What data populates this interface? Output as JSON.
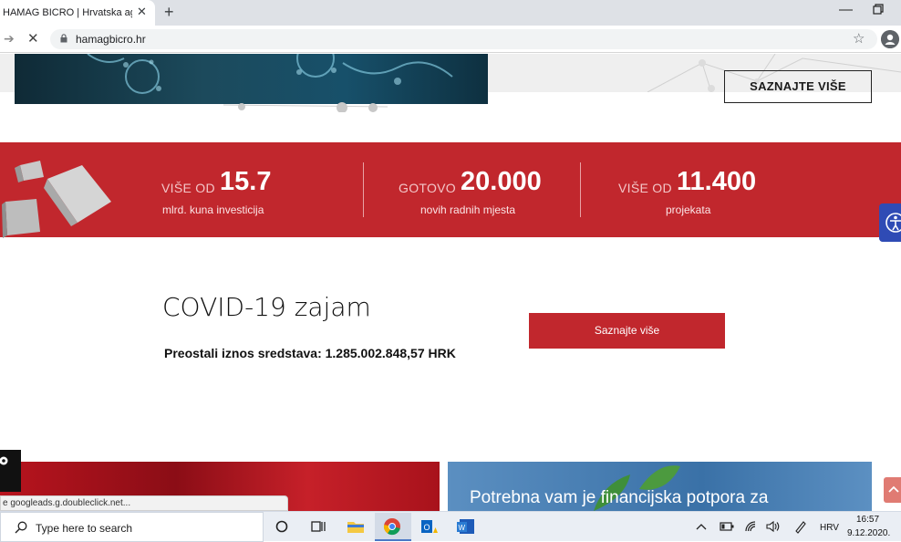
{
  "browser": {
    "tab_title": "HAMAG BICRO | Hrvatska agencij",
    "tab_close": "✕",
    "new_tab": "+",
    "url": "hamagbicro.hr",
    "minimize": "—"
  },
  "hero": {
    "button_label": "SAZNAJTE VIŠE"
  },
  "stats": [
    {
      "prefix": "VIŠE OD",
      "number": "15.7",
      "caption": "mlrd. kuna investicija"
    },
    {
      "prefix": "GOTOVO",
      "number": "20.000",
      "caption": "novih radnih mjesta"
    },
    {
      "prefix": "VIŠE OD",
      "number": "11.400",
      "caption": "projekata"
    }
  ],
  "covid": {
    "title": "COVID-19 zajam",
    "remaining": "Preostali iznos sredstava: 1.285.002.848,57 HRK",
    "button_label": "Saznajte više"
  },
  "cards": {
    "blue_text": "Potrebna vam je financijska potpora za"
  },
  "status_bar": "e googleads.g.doubleclick.net...",
  "taskbar": {
    "search_placeholder": "Type here to search",
    "language": "HRV",
    "time": "16:57",
    "date": "9.12.2020."
  },
  "colors": {
    "brand_red": "#c1272d",
    "accessibility_blue": "#2f4bb5"
  }
}
